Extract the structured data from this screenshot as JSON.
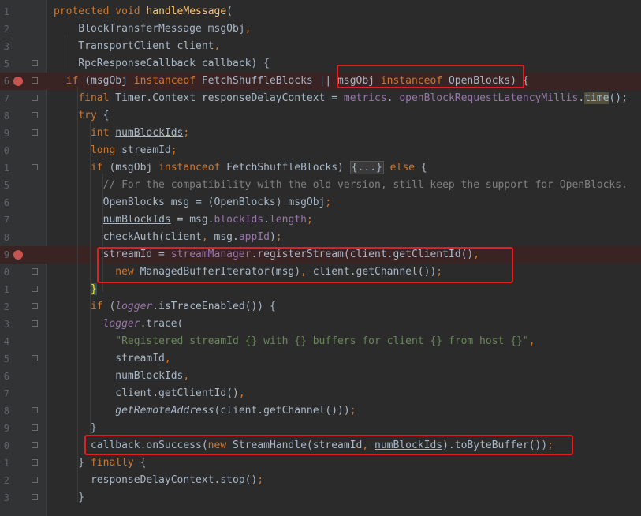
{
  "lines": [
    {
      "n": "1",
      "tokens": [
        [
          "kw",
          "protected "
        ],
        [
          "kw",
          "void "
        ],
        [
          "fn",
          "handleMessage"
        ],
        [
          "",
          "("
        ]
      ]
    },
    {
      "n": "2",
      "tokens": [
        [
          "",
          "    BlockTransferMessage msgObj"
        ],
        [
          "kw",
          ","
        ]
      ]
    },
    {
      "n": "3",
      "tokens": [
        [
          "",
          "    TransportClient client"
        ],
        [
          "kw",
          ","
        ]
      ]
    },
    {
      "n": "5",
      "tokens": [
        [
          "",
          "    RpcResponseCallback callback) {"
        ]
      ]
    },
    {
      "n": "6",
      "tokens": [
        [
          "",
          "  "
        ],
        [
          "kw",
          "if "
        ],
        [
          "",
          "(msgObj "
        ],
        [
          "kw",
          "instanceof "
        ],
        [
          "",
          "FetchShuffleBlocks || msgObj "
        ],
        [
          "kw",
          "instanceof "
        ],
        [
          "",
          "OpenBlocks) {"
        ]
      ]
    },
    {
      "n": "7",
      "tokens": [
        [
          "",
          "    "
        ],
        [
          "kw",
          "final "
        ],
        [
          "",
          "Timer.Context responseDelayContext = "
        ],
        [
          "fld",
          "metrics"
        ],
        [
          "",
          ". "
        ],
        [
          "fld",
          "openBlockRequestLatencyMillis"
        ],
        [
          "",
          "."
        ],
        [
          "hl",
          "time"
        ],
        [
          "",
          "();"
        ]
      ]
    },
    {
      "n": "8",
      "tokens": [
        [
          "",
          "    "
        ],
        [
          "kw",
          "try "
        ],
        [
          "",
          "{"
        ]
      ]
    },
    {
      "n": "9",
      "tokens": [
        [
          "",
          "      "
        ],
        [
          "kw",
          "int "
        ],
        [
          "ul",
          "numBlockIds"
        ],
        [
          "kw",
          ";"
        ]
      ]
    },
    {
      "n": "0",
      "tokens": [
        [
          "",
          "      "
        ],
        [
          "kw",
          "long "
        ],
        [
          "",
          "streamId"
        ],
        [
          "kw",
          ";"
        ]
      ]
    },
    {
      "n": "1",
      "tokens": [
        [
          "",
          "      "
        ],
        [
          "kw",
          "if "
        ],
        [
          "",
          "(msgObj "
        ],
        [
          "kw",
          "instanceof "
        ],
        [
          "",
          "FetchShuffleBlocks) "
        ],
        [
          "fold",
          "{...}"
        ],
        [
          "kw",
          " else "
        ],
        [
          "",
          "{"
        ]
      ]
    },
    {
      "n": "5",
      "tokens": [
        [
          "cmt",
          "        // For the compatibility with the old version, still keep the support for OpenBlocks."
        ]
      ]
    },
    {
      "n": "6",
      "tokens": [
        [
          "",
          "        OpenBlocks msg = (OpenBlocks) msgObj"
        ],
        [
          "kw",
          ";"
        ]
      ]
    },
    {
      "n": "7",
      "tokens": [
        [
          "",
          "        "
        ],
        [
          "ul",
          "numBlockIds"
        ],
        [
          "",
          " = msg."
        ],
        [
          "fld",
          "blockIds"
        ],
        [
          "",
          "."
        ],
        [
          "fld",
          "length"
        ],
        [
          "kw",
          ";"
        ]
      ]
    },
    {
      "n": "8",
      "tokens": [
        [
          "",
          "        checkAuth(client"
        ],
        [
          "kw",
          ", "
        ],
        [
          "",
          "msg."
        ],
        [
          "fld",
          "appId"
        ],
        [
          "",
          ")"
        ],
        [
          "kw",
          ";"
        ]
      ]
    },
    {
      "n": "9",
      "tokens": [
        [
          "",
          "        streamId = "
        ],
        [
          "fld",
          "streamManager"
        ],
        [
          "",
          ".registerStream(client.getClientId()"
        ],
        [
          "kw",
          ","
        ]
      ]
    },
    {
      "n": "0",
      "tokens": [
        [
          "",
          "          "
        ],
        [
          "kw",
          "new "
        ],
        [
          "",
          "ManagedBufferIterator(msg)"
        ],
        [
          "kw",
          ", "
        ],
        [
          "",
          "client.getChannel())"
        ],
        [
          "kw",
          ";"
        ]
      ]
    },
    {
      "n": "1",
      "tokens": [
        [
          "",
          "      "
        ],
        [
          "hlb",
          "}"
        ]
      ]
    },
    {
      "n": "2",
      "tokens": [
        [
          "",
          "      "
        ],
        [
          "kw",
          "if "
        ],
        [
          "",
          "("
        ],
        [
          "italfld",
          "logger"
        ],
        [
          "",
          ".isTraceEnabled()) {"
        ]
      ]
    },
    {
      "n": "3",
      "tokens": [
        [
          "",
          "        "
        ],
        [
          "italfld",
          "logger"
        ],
        [
          "",
          ".trace("
        ]
      ]
    },
    {
      "n": "4",
      "tokens": [
        [
          "",
          "          "
        ],
        [
          "str",
          "\"Registered streamId {} with {} buffers for client {} from host {}\""
        ],
        [
          "kw",
          ","
        ]
      ]
    },
    {
      "n": "5",
      "tokens": [
        [
          "",
          "          streamId"
        ],
        [
          "kw",
          ","
        ]
      ]
    },
    {
      "n": "6",
      "tokens": [
        [
          "",
          "          "
        ],
        [
          "ul",
          "numBlockIds"
        ],
        [
          "kw",
          ","
        ]
      ]
    },
    {
      "n": "7",
      "tokens": [
        [
          "",
          "          client.getClientId()"
        ],
        [
          "kw",
          ","
        ]
      ]
    },
    {
      "n": "8",
      "tokens": [
        [
          "",
          "          "
        ],
        [
          "ital",
          "getRemoteAddress"
        ],
        [
          "",
          "(client.getChannel()))"
        ],
        [
          "kw",
          ";"
        ]
      ]
    },
    {
      "n": "9",
      "tokens": [
        [
          "",
          "      }"
        ]
      ]
    },
    {
      "n": "0",
      "tokens": [
        [
          "",
          "      callback.onSuccess("
        ],
        [
          "kw",
          "new "
        ],
        [
          "",
          "StreamHandle(streamId"
        ],
        [
          "kw",
          ", "
        ],
        [
          "ul",
          "numBlockIds"
        ],
        [
          "",
          ").toByteBuffer())"
        ],
        [
          "kw",
          ";"
        ]
      ]
    },
    {
      "n": "1",
      "tokens": [
        [
          "",
          "    } "
        ],
        [
          "kw",
          "finally "
        ],
        [
          "",
          "{"
        ]
      ]
    },
    {
      "n": "2",
      "tokens": [
        [
          "",
          "      responseDelayContext.stop()"
        ],
        [
          "kw",
          ";"
        ]
      ]
    },
    {
      "n": "3",
      "tokens": [
        [
          "",
          "    }"
        ]
      ]
    }
  ],
  "breakpoint_lines": [
    4,
    14
  ],
  "fold_marker_lines": [
    3,
    4,
    5,
    6,
    7,
    9,
    15,
    16,
    17,
    18,
    20,
    23,
    24,
    25,
    26,
    27,
    28
  ],
  "colors": {
    "background": "#2b2b2b",
    "keyword": "#cc7832",
    "method": "#ffc66d",
    "field": "#9876aa",
    "string": "#6a8759",
    "comment": "#808080",
    "breakpoint": "#c75450",
    "annotation_box": "#e02020"
  }
}
